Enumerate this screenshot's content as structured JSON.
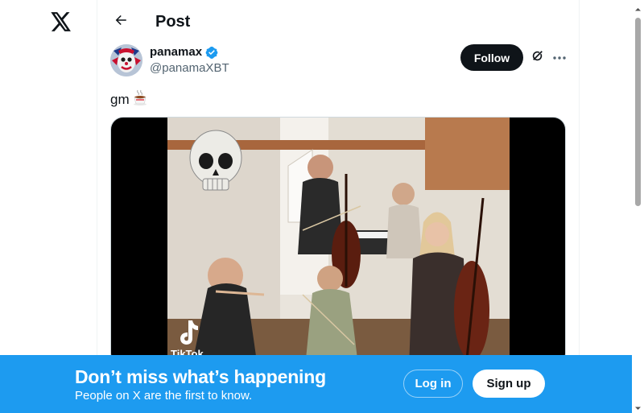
{
  "header": {
    "title": "Post",
    "back_icon": "arrow-left-icon"
  },
  "nav": {
    "logo_icon": "x-logo-icon"
  },
  "post": {
    "author": {
      "display_name": "panamax",
      "handle": "@panamaXBT",
      "verified": true,
      "verified_color": "#1d9bf0"
    },
    "follow_label": "Follow",
    "grok_icon": "grok-icon",
    "more_icon": "more-icon",
    "text": "gm",
    "text_emoji": "coffee-icon",
    "media": {
      "type": "video",
      "watermark": "TikTok"
    }
  },
  "banner": {
    "title": "Don’t miss what’s happening",
    "subtitle": "People on X are the first to know.",
    "login_label": "Log in",
    "signup_label": "Sign up",
    "color": "#1d9bf0"
  },
  "colors": {
    "text_primary": "#0f1419",
    "text_secondary": "#536471",
    "accent": "#1d9bf0"
  }
}
